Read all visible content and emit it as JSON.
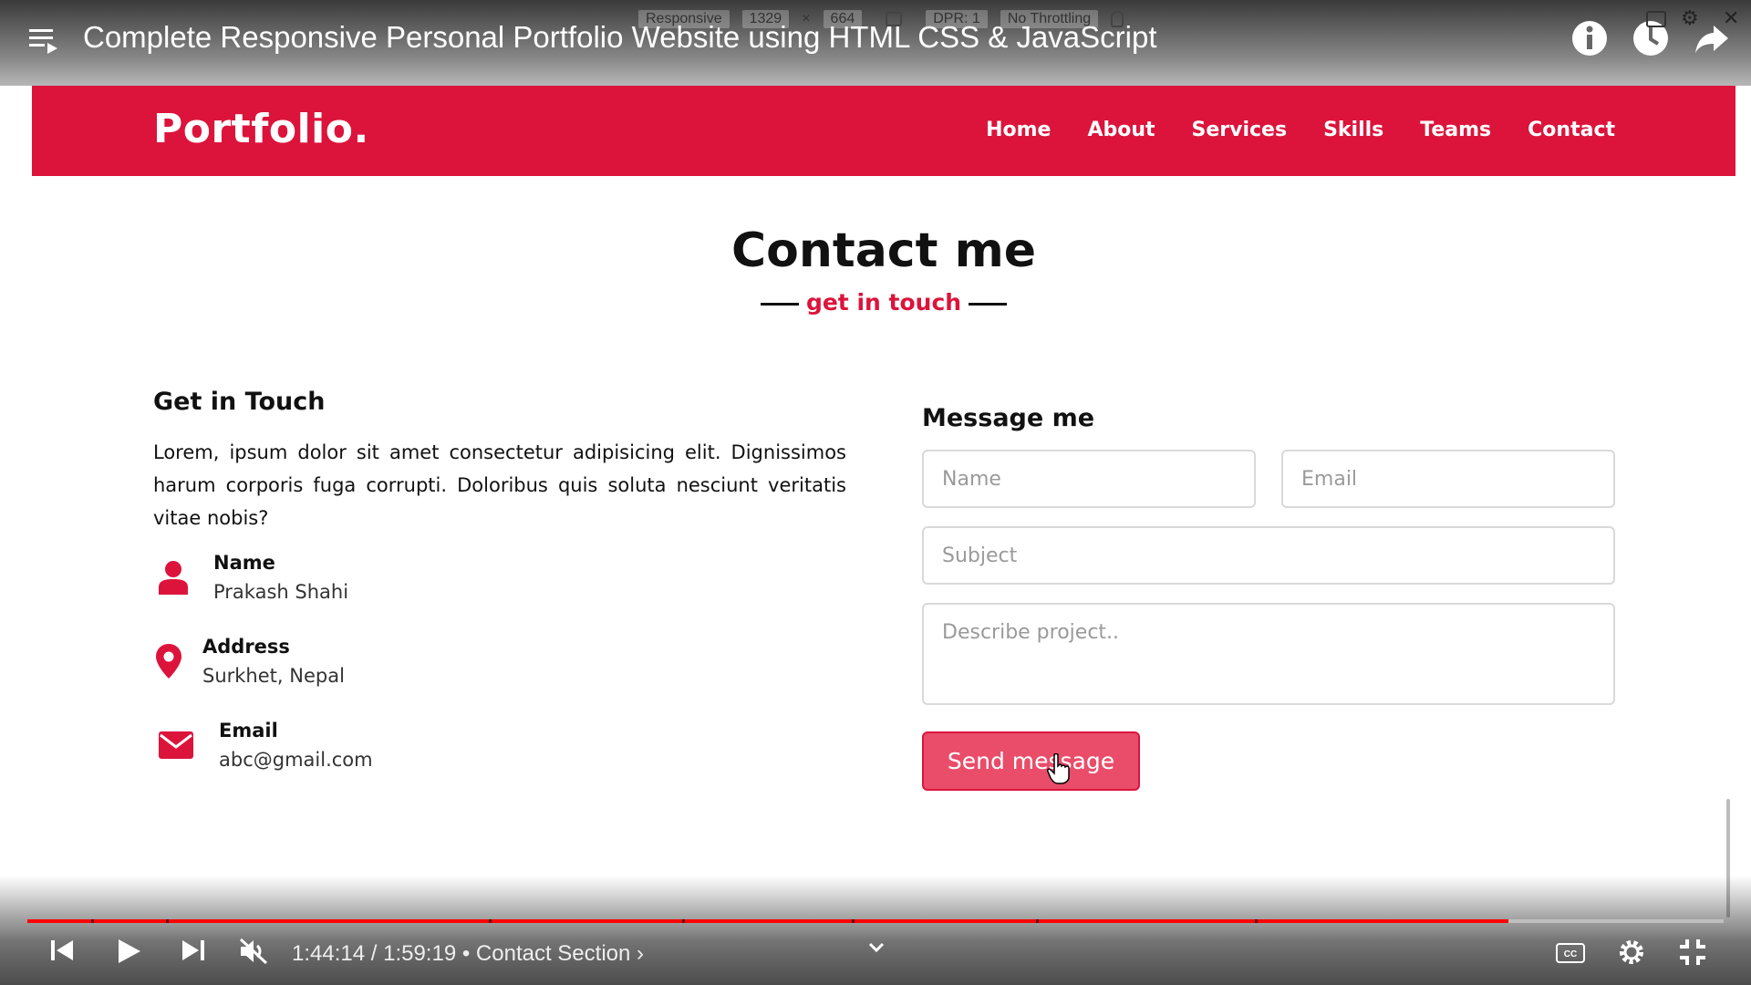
{
  "video": {
    "title": "Complete Responsive Personal Portfolio Website using HTML CSS & JavaScript",
    "time_current": "1:44:14",
    "time_total": "1:59:19",
    "chapter": "Contact Section",
    "progress_fraction": 0.873,
    "icons": [
      "playlist-icon",
      "info-icon",
      "watch-later-icon",
      "share-icon",
      "prev-icon",
      "play-icon",
      "next-icon",
      "mute-icon",
      "captions-icon",
      "settings-icon",
      "exit-fullscreen-icon"
    ]
  },
  "devtools": {
    "mode": "Responsive",
    "width": "1329",
    "times": "×",
    "height": "664",
    "dpr": "DPR: 1",
    "throttling": "No Throttling"
  },
  "site": {
    "logo": "Portfolio.",
    "nav": [
      "Home",
      "About",
      "Services",
      "Skills",
      "Teams",
      "Contact"
    ],
    "accent": "#dc143c"
  },
  "contact": {
    "title": "Contact me",
    "subtitle": "get in touch",
    "left": {
      "heading": "Get in Touch",
      "paragraph": "Lorem, ipsum dolor sit amet consectetur adipisicing elit. Dignissimos harum corporis fuga corrupti. Doloribus quis soluta nesciunt veritatis vitae nobis?",
      "items": [
        {
          "icon": "user-icon",
          "label": "Name",
          "value": "Prakash Shahi"
        },
        {
          "icon": "map-pin-icon",
          "label": "Address",
          "value": "Surkhet, Nepal"
        },
        {
          "icon": "envelope-icon",
          "label": "Email",
          "value": "abc@gmail.com"
        }
      ]
    },
    "form": {
      "heading": "Message me",
      "name_placeholder": "Name",
      "email_placeholder": "Email",
      "subject_placeholder": "Subject",
      "message_placeholder": "Describe project..",
      "send_label": "Send message"
    }
  }
}
